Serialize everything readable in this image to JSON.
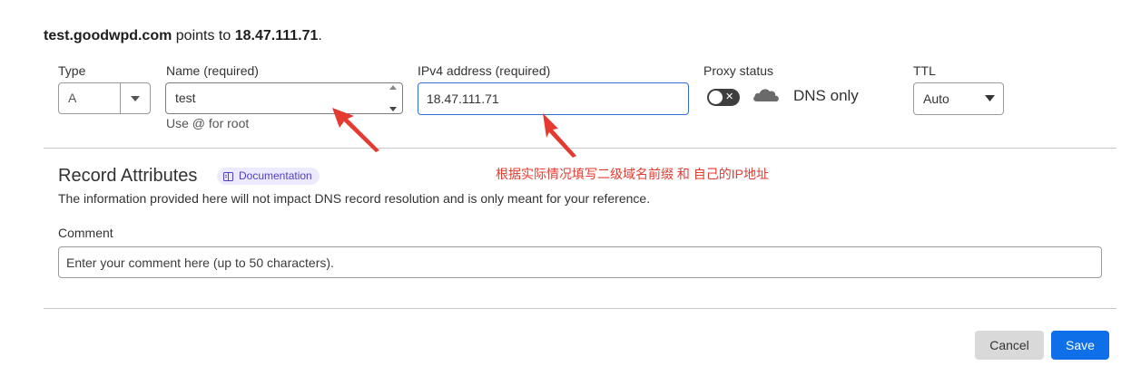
{
  "summary": {
    "domain": "test.goodwpd.com",
    "connector": " points to ",
    "ip": "18.47.111.71",
    "end": "."
  },
  "fields": {
    "type_label": "Type",
    "type_value": "A",
    "name_label": "Name (required)",
    "name_value": "test",
    "name_hint": "Use @ for root",
    "ipv4_label": "IPv4 address (required)",
    "ipv4_value": "18.47.111.71",
    "proxy_label": "Proxy status",
    "proxy_state": "DNS only",
    "proxy_enabled": false,
    "ttl_label": "TTL",
    "ttl_value": "Auto"
  },
  "attributes": {
    "title": "Record Attributes",
    "doc_badge": "Documentation",
    "description": "The information provided here will not impact DNS record resolution and is only meant for your reference.",
    "comment_label": "Comment",
    "comment_placeholder": "Enter your comment here (up to 50 characters)."
  },
  "annotation": {
    "text": "根据实际情况填写二级域名前缀 和 自己的IP地址",
    "color": "#e53a2f"
  },
  "actions": {
    "cancel": "Cancel",
    "save": "Save"
  },
  "colors": {
    "primary": "#0f6fe8",
    "badge_bg": "#eceaff",
    "badge_text": "#5140c4",
    "focus_border": "#2f6fd1"
  },
  "icons": {
    "type_caret": "caret-down-icon",
    "spinner": "spinner-arrows-icon",
    "proxy_cloud": "cloud-icon",
    "ttl_caret": "caret-down-icon",
    "documentation": "book-icon",
    "toggle_off": "x-icon"
  }
}
